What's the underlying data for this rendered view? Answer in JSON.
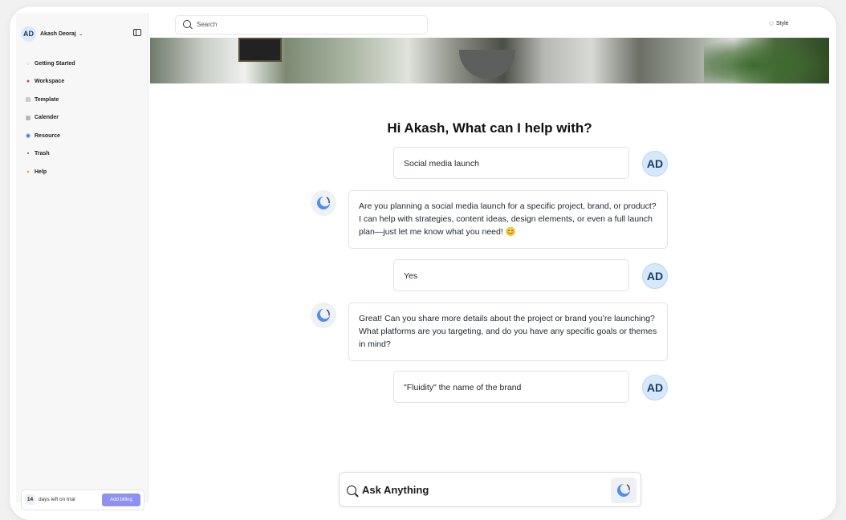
{
  "sidebar": {
    "user": {
      "initials": "AD",
      "name": "Akash Deoraj"
    },
    "items": [
      {
        "label": "Getting Started",
        "icon": "○",
        "icon_name": "getting-started-icon",
        "color": "#9aa0a6"
      },
      {
        "label": "Workspace",
        "icon": "●",
        "icon_name": "workspace-icon",
        "color": "#d24a3a"
      },
      {
        "label": "Template",
        "icon": "▤",
        "icon_name": "template-icon",
        "color": "#8a8f99"
      },
      {
        "label": "Calender",
        "icon": "▦",
        "icon_name": "calendar-icon",
        "color": "#8a8f99"
      },
      {
        "label": "Resource",
        "icon": "◉",
        "icon_name": "globe-icon",
        "color": "#2f6fd6"
      },
      {
        "label": "Trash",
        "icon": "▪",
        "icon_name": "trash-icon",
        "color": "#2f7a3b"
      },
      {
        "label": "Help",
        "icon": "●",
        "icon_name": "help-icon",
        "color": "#f2b531"
      }
    ],
    "trial": {
      "days": "14",
      "text": "days left on trial",
      "button": "Add billing"
    }
  },
  "topbar": {
    "search_placeholder": "Search",
    "style_label": "Style"
  },
  "chat": {
    "heading": "Hi Akash, What can I help with?",
    "avatar_initials": "AD",
    "messages": [
      {
        "role": "user",
        "text": "Social media launch"
      },
      {
        "role": "bot",
        "text": "Are you planning a social media launch for a specific project, brand, or product? I can help with strategies, content ideas, design elements, or even a full launch plan—just let me know what you need! 😊"
      },
      {
        "role": "user",
        "text": "Yes"
      },
      {
        "role": "bot",
        "text": "Great! Can you share more details about the project or brand you’re launching? What platforms are you targeting, and do you have any specific goals or themes in mind?"
      },
      {
        "role": "user",
        "text": "\"Fluidity\" the name of the brand"
      }
    ],
    "input_placeholder": "Ask Anything"
  },
  "colors": {
    "accent": "#8f91f2",
    "avatar_bg": "#d6e9fb",
    "bot_icon_blue": "#4e8ef0"
  }
}
